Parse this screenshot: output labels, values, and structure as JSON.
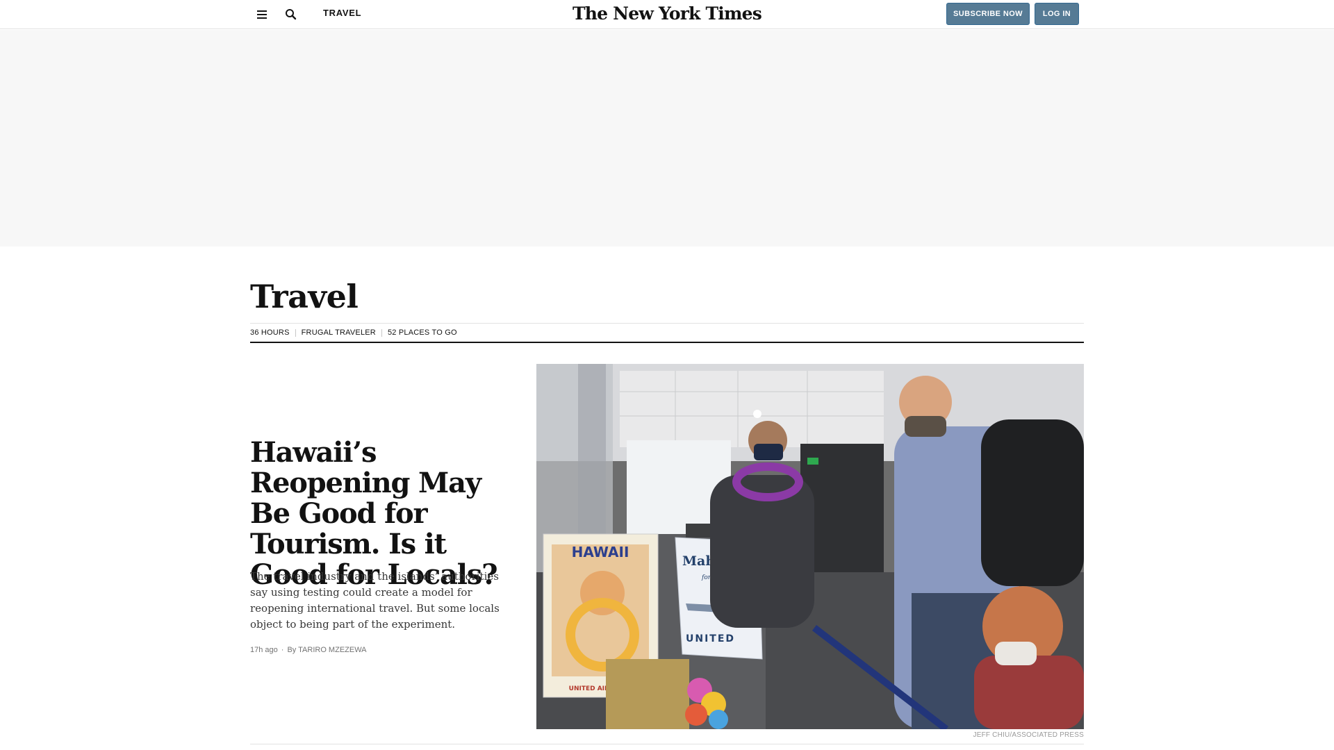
{
  "header": {
    "section_label": "TRAVEL",
    "masthead": "The New York Times",
    "subscribe_label": "SUBSCRIBE NOW",
    "login_label": "LOG IN",
    "icons": {
      "menu": "hamburger-menu-icon",
      "search": "search-icon"
    },
    "accent_color": "#567b95"
  },
  "section": {
    "title": "Travel",
    "subnav": [
      "36 HOURS",
      "FRUGAL TRAVELER",
      "52 PLACES TO GO"
    ]
  },
  "lead_story": {
    "headline": "Hawaii’s Reopening May Be Good for Tourism. Is it Good for Locals?",
    "summary": "The travel industry and the islands’ authorities say using testing could create a model for reopening international travel. But some locals object to being part of the experiment.",
    "timestamp": "17h ago",
    "byline_prefix": "By",
    "author": "TARIRO MZEZEWA",
    "photo_credit": "JEFF CHIU/ASSOCIATED PRESS",
    "photo_signage": {
      "poster_left": "HAWAII",
      "poster_left_bottom": "UNITED AIR LINES",
      "poster_right": "Mahalo",
      "poster_right_sub": "for flying",
      "poster_right_brand": "UNITED"
    }
  }
}
